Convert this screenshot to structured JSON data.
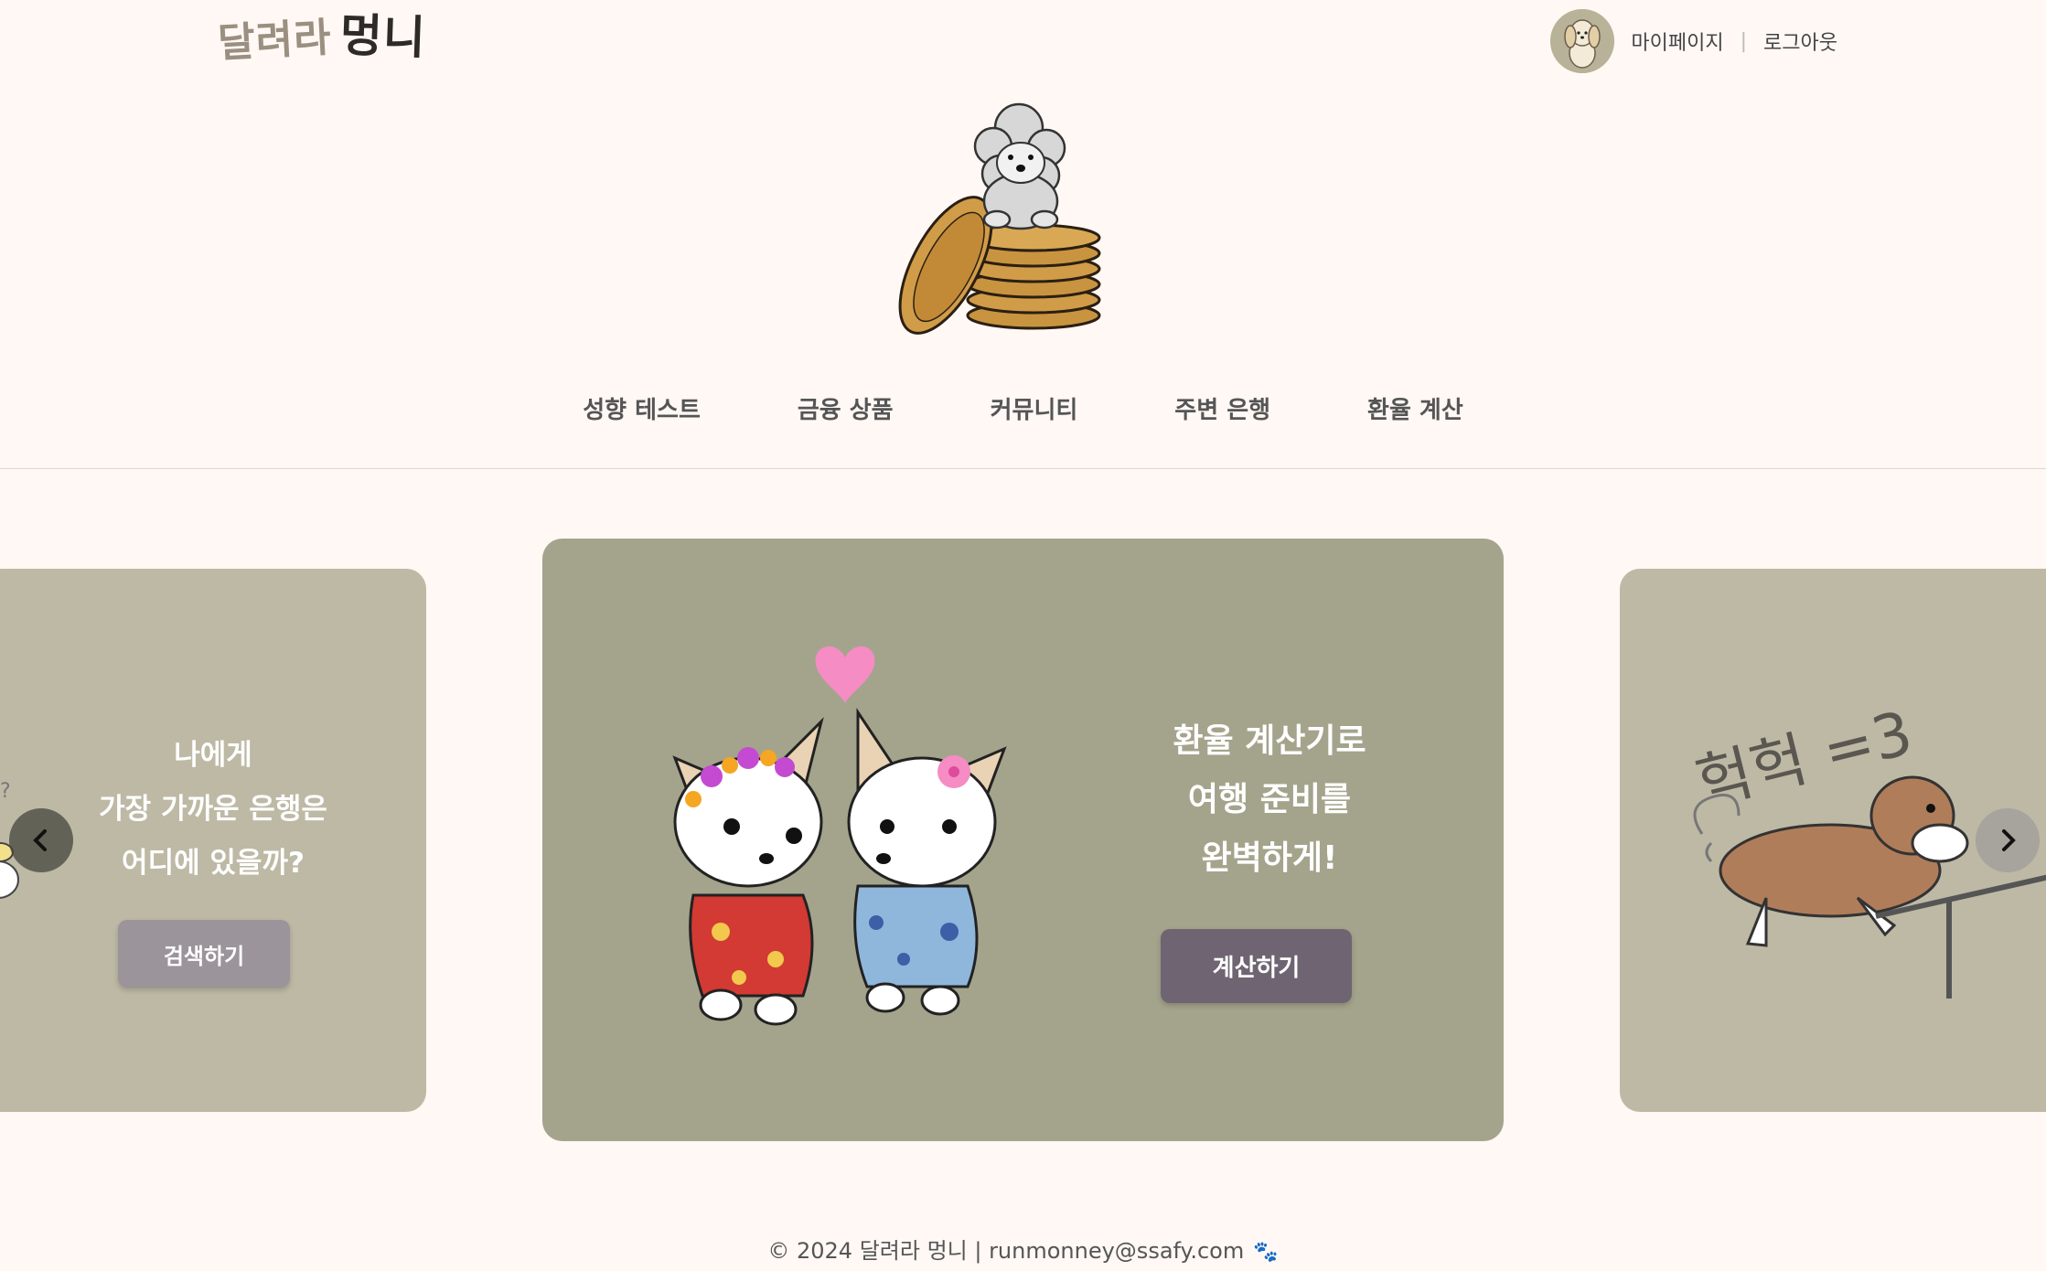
{
  "header": {
    "logo_part1": "달려라",
    "logo_part2": "멍니",
    "mypage_label": "마이페이지",
    "separator": "|",
    "logout_label": "로그아웃"
  },
  "nav": {
    "items": [
      {
        "label": "성향 테스트"
      },
      {
        "label": "금융 상품"
      },
      {
        "label": "커뮤니티"
      },
      {
        "label": "주변 은행"
      },
      {
        "label": "환율 계산"
      }
    ]
  },
  "carousel": {
    "slides": [
      {
        "text": "나에게\n가장 가까운 은행은\n어디에 있을까?",
        "button": "검색하기"
      },
      {
        "text": "환율 계산기로\n여행 준비를\n완벽하게!",
        "button": "계산하기"
      },
      {
        "handwriting": "헉헉 =3"
      }
    ]
  },
  "footer": {
    "text": "© 2024 달려라 멍니 | runmonney@ssafy.com",
    "icon": "paw-icon"
  },
  "colors": {
    "background": "#fff8f4",
    "slide_side": "#bdb9a5",
    "slide_center": "#a4a48d",
    "button_side": "#9b949a",
    "button_center": "#6f6572"
  }
}
